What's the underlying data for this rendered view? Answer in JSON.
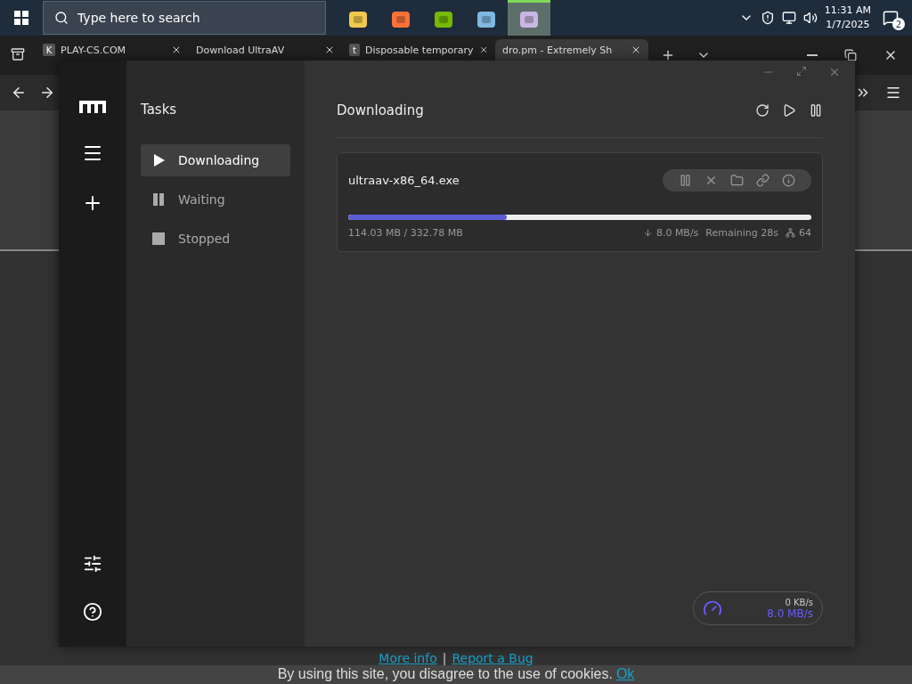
{
  "taskbar": {
    "search_placeholder": "Type here to search",
    "apps": [
      {
        "kind": "folder",
        "selected": false
      },
      {
        "kind": "browser",
        "selected": false
      },
      {
        "kind": "gpu",
        "selected": false
      },
      {
        "kind": "notes",
        "selected": false
      },
      {
        "kind": "disk",
        "selected": true
      }
    ],
    "time": "11:31 AM",
    "date": "1/7/2025",
    "notification_count": "2"
  },
  "browser": {
    "tabs": [
      {
        "title": "PLAY-CS.COM",
        "favicon": "K",
        "selected": false
      },
      {
        "title": "Download UltraAV",
        "selected": false
      },
      {
        "title": "Disposable temporary",
        "favicon": "t",
        "selected": false
      },
      {
        "title": "dro.pm - Extremely Sh",
        "selected": true
      }
    ]
  },
  "motrix": {
    "sidebar_title": "Tasks",
    "nav": [
      {
        "label": "Downloading",
        "kind": "play",
        "selected": true
      },
      {
        "label": "Waiting",
        "kind": "pause",
        "selected": false
      },
      {
        "label": "Stopped",
        "kind": "stop",
        "selected": false
      }
    ],
    "main_title": "Downloading",
    "tasks": [
      {
        "name": "ultraav-x86_64.exe",
        "progress": "114.03 MB / 332.78 MB",
        "level": 0.343,
        "speed": "8.0 MB/s",
        "remaining": "Remaining 28s",
        "connections": "64"
      }
    ],
    "speedometer": {
      "upload": "0 KB/s",
      "download": "8.0 MB/s"
    }
  },
  "page": {
    "links": [
      "More info",
      "Report a Bug"
    ],
    "separator": "|",
    "cookie_text": "By using this site, you disagree to the use of cookies.",
    "cookie_ok": "Ok"
  }
}
